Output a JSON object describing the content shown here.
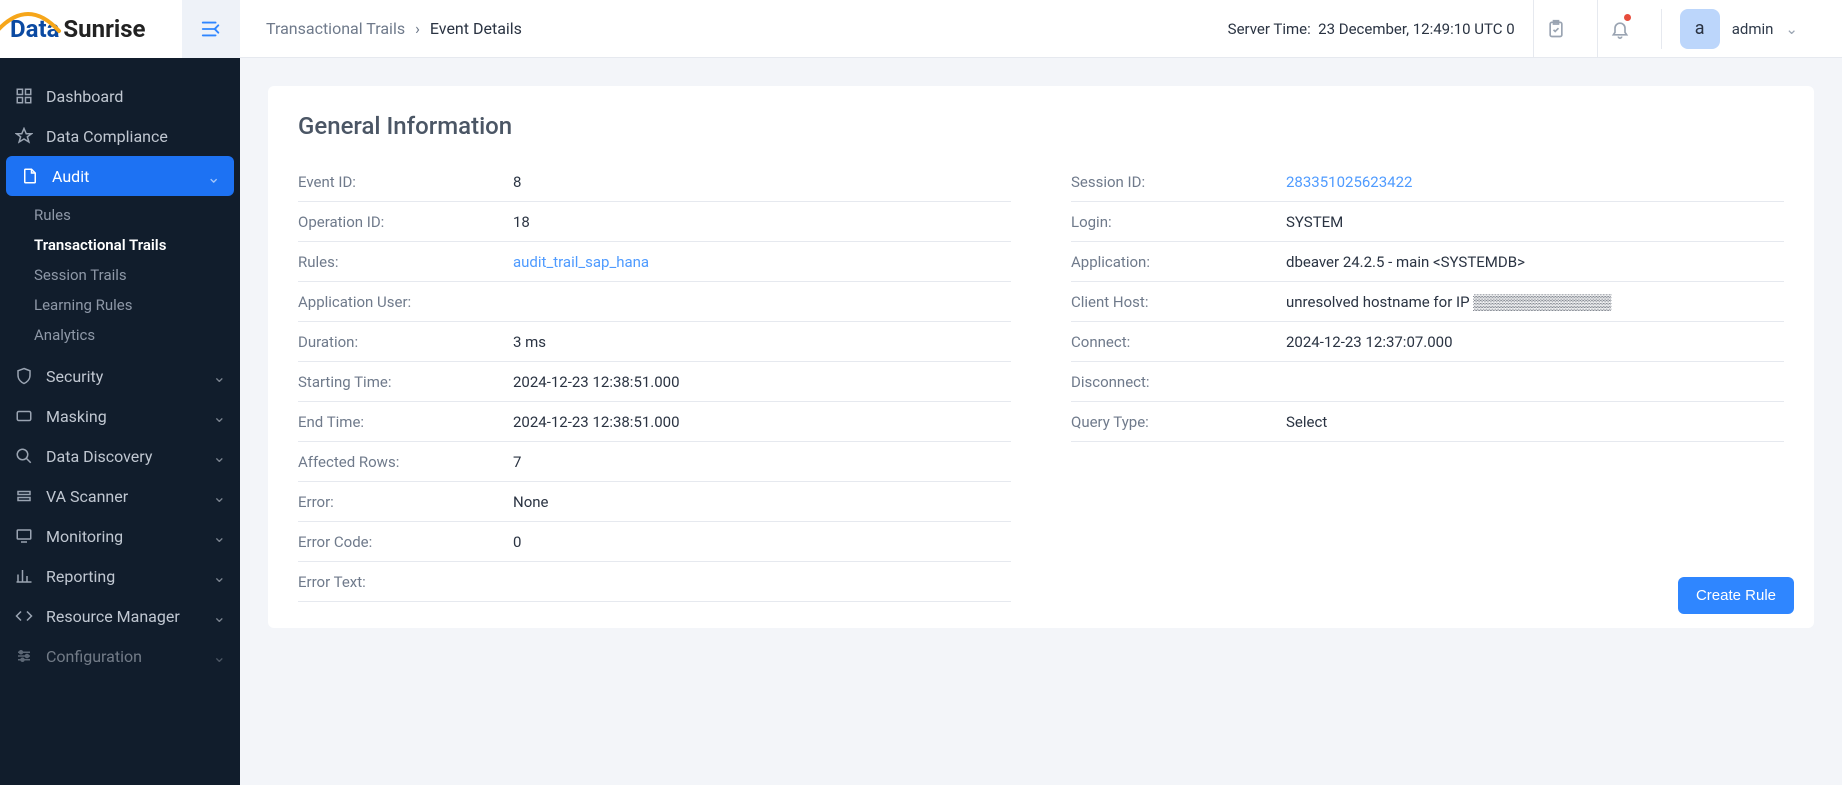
{
  "logo": {
    "part1": "Data",
    "part2": "Sunrise"
  },
  "header": {
    "breadcrumb": {
      "root": "Transactional Trails",
      "current": "Event Details"
    },
    "server_time_label": "Server Time:",
    "server_time_value": "23 December, 12:49:10  UTC 0",
    "user_initial": "a",
    "user_name": "admin"
  },
  "nav": {
    "dashboard": "Dashboard",
    "compliance": "Data Compliance",
    "audit": "Audit",
    "audit_sub": {
      "rules": "Rules",
      "trans": "Transactional Trails",
      "session": "Session Trails",
      "learning": "Learning Rules",
      "analytics": "Analytics"
    },
    "security": "Security",
    "masking": "Masking",
    "discovery": "Data Discovery",
    "va": "VA Scanner",
    "monitoring": "Monitoring",
    "reporting": "Reporting",
    "resource": "Resource Manager",
    "config": "Configuration"
  },
  "section_title": "General Information",
  "left_rows": [
    {
      "k": "Event ID:",
      "v": "8"
    },
    {
      "k": "Operation ID:",
      "v": "18"
    },
    {
      "k": "Rules:",
      "v": "audit_trail_sap_hana",
      "link": true
    },
    {
      "k": "Application User:",
      "v": ""
    },
    {
      "k": "Duration:",
      "v": "3 ms"
    },
    {
      "k": "Starting Time:",
      "v": "2024-12-23 12:38:51.000"
    },
    {
      "k": "End Time:",
      "v": "2024-12-23 12:38:51.000"
    },
    {
      "k": "Affected Rows:",
      "v": "7"
    },
    {
      "k": "Error:",
      "v": "None"
    },
    {
      "k": "Error Code:",
      "v": "0"
    },
    {
      "k": "Error Text:",
      "v": ""
    }
  ],
  "right_rows": [
    {
      "k": "Session ID:",
      "v": "283351025623422",
      "link": true
    },
    {
      "k": "Login:",
      "v": "SYSTEM"
    },
    {
      "k": "Application:",
      "v": "dbeaver 24.2.5 - main <SYSTEMDB>"
    },
    {
      "k": "Client Host:",
      "v": "unresolved hostname for IP ▒▒▒▒▒▒▒▒▒▒▒▒▒"
    },
    {
      "k": "Connect:",
      "v": "2024-12-23 12:37:07.000"
    },
    {
      "k": "Disconnect:",
      "v": ""
    },
    {
      "k": "Query Type:",
      "v": "Select"
    }
  ],
  "create_rule_btn": "Create Rule"
}
